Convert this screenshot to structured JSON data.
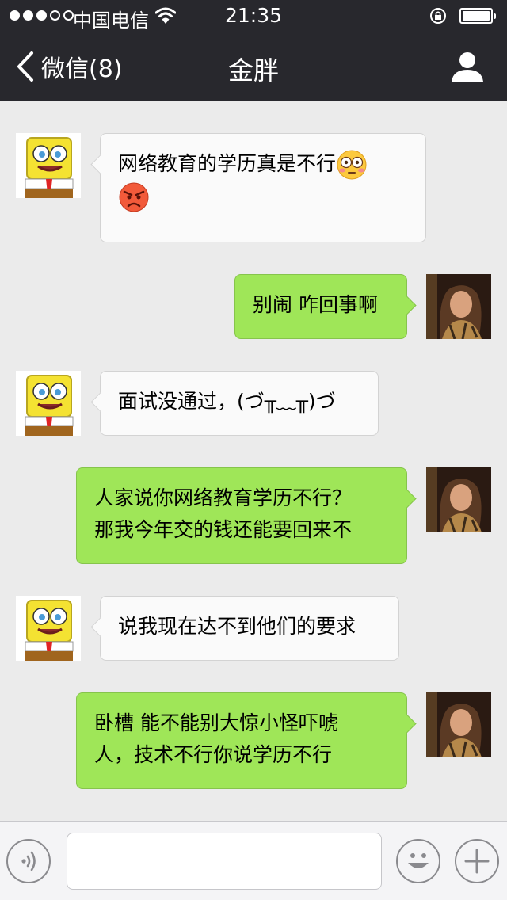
{
  "status_bar": {
    "carrier": "中国电信",
    "time": "21:35"
  },
  "nav": {
    "back_label": "微信(8)",
    "title": "金胖",
    "back_icon": "chevron-left-icon",
    "profile_icon": "person-icon"
  },
  "messages": [
    {
      "side": "in",
      "text": "网络教育的学历真是不行",
      "trailing_emoji": [
        "flushed-face-emoji",
        "angry-face-emoji"
      ]
    },
    {
      "side": "out",
      "text": "别闹 咋回事啊"
    },
    {
      "side": "in",
      "text": "面试没通过，(づ╥﹏╥)づ"
    },
    {
      "side": "out",
      "text": "人家说你网络教育学历不行？\n那我今年交的钱还能要回来不"
    },
    {
      "side": "in",
      "text": "说我现在达不到他们的要求"
    },
    {
      "side": "out",
      "text": "卧槽 能不能别大惊小怪吓唬\n人，技术不行你说学历不行"
    }
  ],
  "input_bar": {
    "placeholder": "",
    "voice_icon": "voice-icon",
    "emoji_icon": "smiley-icon",
    "plus_icon": "plus-icon"
  },
  "colors": {
    "nav_bg": "#28282d",
    "chat_bg": "#ebebeb",
    "incoming_bubble": "#fafafa",
    "outgoing_bubble": "#9fe658"
  }
}
